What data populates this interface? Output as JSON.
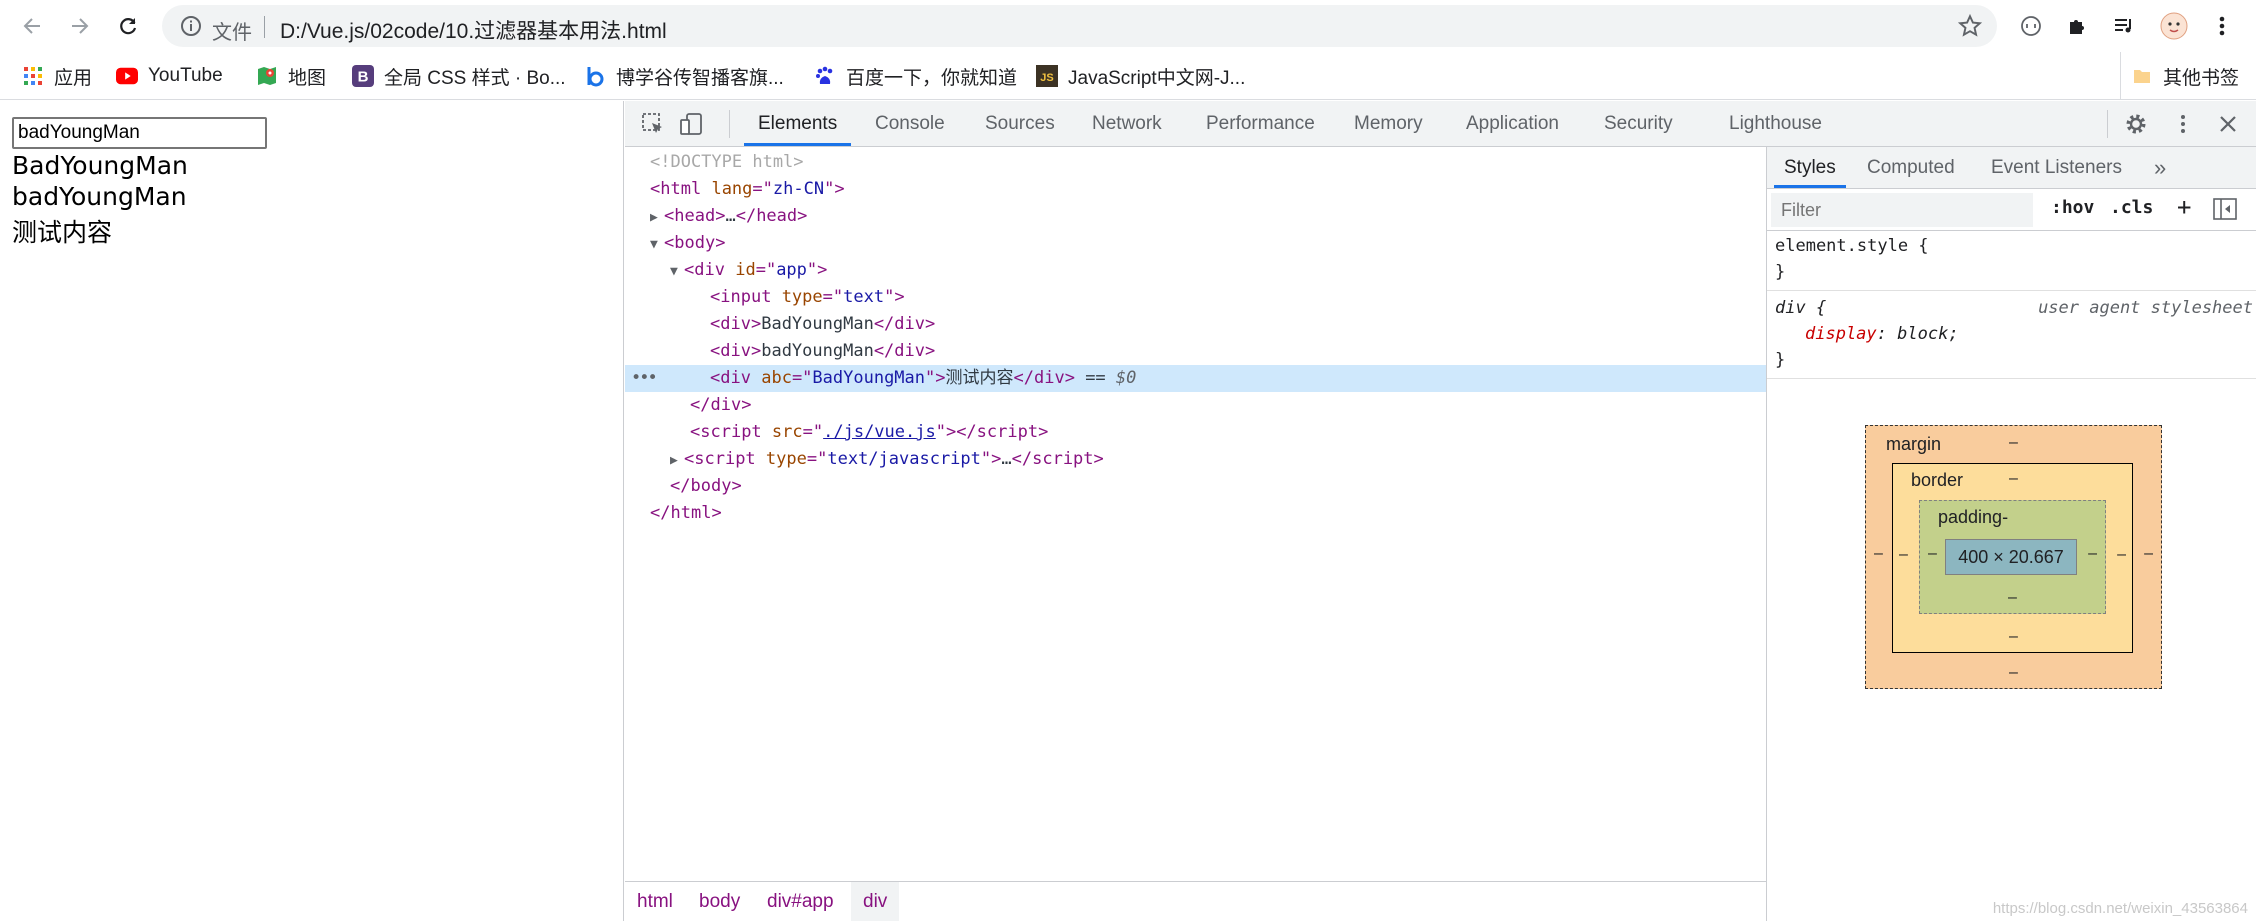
{
  "toolbar": {
    "address_label": "文件",
    "address_url": "D:/Vue.js/02code/10.过滤器基本用法.html"
  },
  "bookmarks": [
    {
      "label": "应用",
      "icon": "apps-grid-icon"
    },
    {
      "label": "YouTube",
      "icon": "youtube-icon"
    },
    {
      "label": "地图",
      "icon": "maps-icon"
    },
    {
      "label": "全局 CSS 样式 · Bo...",
      "icon": "bootstrap-icon"
    },
    {
      "label": "博学谷传智播客旗...",
      "icon": "bokecc-icon"
    },
    {
      "label": "百度一下，你就知道",
      "icon": "baidu-icon"
    },
    {
      "label": "JavaScript中文网-J...",
      "icon": "js-icon"
    },
    {
      "label": "其他书签",
      "icon": "folder-icon"
    }
  ],
  "page": {
    "input_value": "badYoungMan",
    "lines": [
      "BadYoungMan",
      "badYoungMan",
      "测试内容"
    ]
  },
  "devtools": {
    "tabs": [
      "Elements",
      "Console",
      "Sources",
      "Network",
      "Performance",
      "Memory",
      "Application",
      "Security",
      "Lighthouse"
    ],
    "active_tab": "Elements",
    "dom": {
      "doctype": "<!DOCTYPE html>",
      "html_open_tag": "html",
      "lang_attr": "lang",
      "lang_val": "zh-CN",
      "head": "head",
      "ellipsis": "…",
      "body": "body",
      "div": "div",
      "id_attr": "id",
      "id_val": "app",
      "input": "input",
      "type_attr": "type",
      "type_val": "text",
      "text1": "BadYoungMan",
      "text2": "badYoungMan",
      "abc_attr": "abc",
      "abc_val": "BadYoungMan",
      "text3": "测试内容",
      "eq": " == ",
      "dollar": "$0",
      "script": "script",
      "src_attr": "src",
      "src_val": "./js/vue.js",
      "script_type_val": "text/javascript",
      "html_close": "html"
    },
    "breadcrumbs": [
      "html",
      "body",
      "div#app",
      "div"
    ],
    "styles": {
      "tabs": [
        "Styles",
        "Computed",
        "Event Listeners"
      ],
      "more": "»",
      "filter_placeholder": "Filter",
      "hov": ":hov",
      "cls": ".cls",
      "plus": "+",
      "element_style": "element.style {",
      "close_brace": "}",
      "div_selector": "div {",
      "ua_label": "user agent stylesheet",
      "prop_name": "display",
      "prop_value": "block;"
    },
    "box_model": {
      "margin_label": "margin",
      "border_label": "border",
      "padding_label": "padding-",
      "content_size": "400 × 20.667",
      "dash": "–"
    }
  },
  "watermark": "https://blog.csdn.net/weixin_43563864"
}
